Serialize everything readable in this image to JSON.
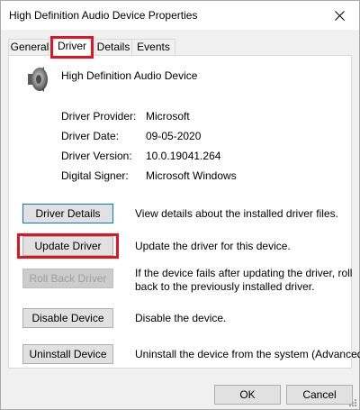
{
  "window": {
    "title": "High Definition Audio Device Properties"
  },
  "tabs": [
    "General",
    "Driver",
    "Details",
    "Events"
  ],
  "device": {
    "name": "High Definition Audio Device"
  },
  "info": [
    {
      "label": "Driver Provider:",
      "value": "Microsoft"
    },
    {
      "label": "Driver Date:",
      "value": "09-05-2020"
    },
    {
      "label": "Driver Version:",
      "value": "10.0.19041.264"
    },
    {
      "label": "Digital Signer:",
      "value": "Microsoft Windows"
    }
  ],
  "actions": [
    {
      "label": "Driver Details",
      "desc": [
        "View details about the installed driver files."
      ]
    },
    {
      "label": "Update Driver",
      "desc": [
        "Update the driver for this device."
      ]
    },
    {
      "label": "Roll Back Driver",
      "desc": [
        "If the device fails after updating the driver, roll",
        "back to the previously installed driver."
      ]
    },
    {
      "label": "Disable Device",
      "desc": [
        "Disable the device."
      ]
    },
    {
      "label": "Uninstall Device",
      "desc": [
        "Uninstall the device from the system (Advanced)."
      ]
    }
  ],
  "footer": {
    "ok": "OK",
    "cancel": "Cancel"
  },
  "colors": {
    "highlight": "#e3141f",
    "focus": "#0078d7"
  },
  "icons": {
    "close": "close-icon",
    "device": "speaker-icon",
    "resize": "resize-grip-icon"
  }
}
